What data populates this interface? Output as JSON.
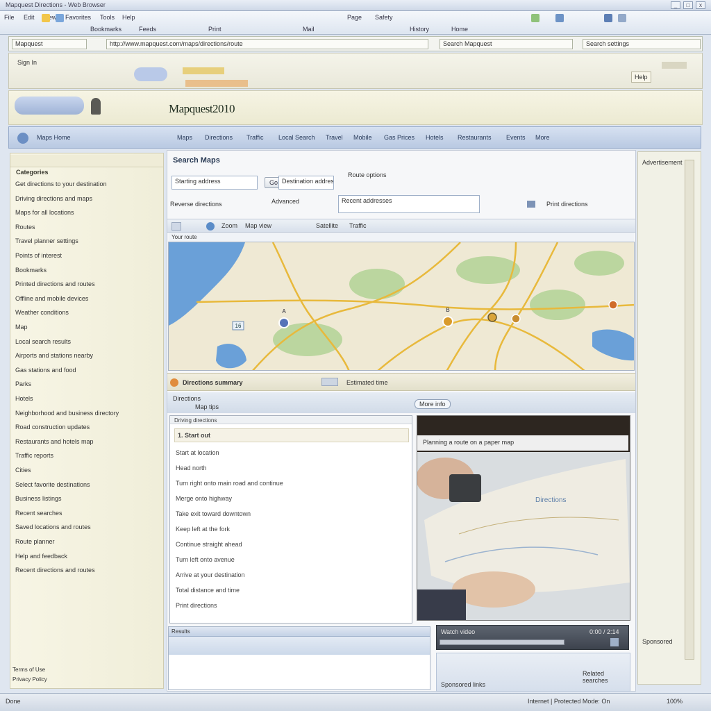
{
  "window": {
    "title": "Mapquest Directions - Web Browser",
    "controls": [
      "_",
      "□",
      "x"
    ]
  },
  "menubar": {
    "items": [
      "File",
      "Edit",
      "View",
      "Favorites",
      "Tools",
      "Help",
      "Page",
      "Safety"
    ],
    "links": [
      "Bookmarks",
      "Feeds",
      "Print",
      "Mail",
      "History",
      "Home"
    ]
  },
  "address": {
    "tab_label": "Mapquest",
    "url": "http://www.mapquest.com/maps/directions/route",
    "search_label": "Search Mapquest",
    "right_label": "Search settings"
  },
  "banner": {
    "logo": "Mapquest2010",
    "signin_label": "Sign In",
    "help_label": "Help"
  },
  "nav": {
    "home_label": "Maps Home",
    "links": [
      "Maps",
      "Directions",
      "Traffic",
      "Local Search",
      "Travel",
      "Mobile",
      "Gas Prices",
      "Hotels",
      "Restaurants",
      "Events",
      "More"
    ]
  },
  "sidebar": {
    "heading": "Categories",
    "items": [
      "Get directions to your destination",
      "Driving directions and maps",
      "Maps for all locations",
      "Routes",
      "Travel planner settings",
      "Points of interest",
      "Bookmarks",
      "Printed directions and routes",
      "Offline and mobile devices",
      "Weather conditions",
      "Map",
      "Local search results",
      "Airports and stations nearby",
      "Gas stations and food",
      "Parks",
      "Hotels",
      "Neighborhood and business directory",
      "Road construction updates",
      "Restaurants and hotels map",
      "Traffic reports",
      "Cities",
      "Select favorite destinations",
      "Business listings",
      "Recent searches",
      "Saved locations and routes",
      "Route planner",
      "Help and feedback",
      "Recent directions and routes"
    ],
    "footer_a": "Terms of Use",
    "footer_b": "Privacy Policy"
  },
  "search": {
    "heading": "Search Maps",
    "start_placeholder": "Starting address",
    "end_placeholder": "Destination address",
    "go_label": "Go",
    "options_label": "Route options",
    "reverse_label": "Reverse directions",
    "advanced_label": "Advanced",
    "recent_label": "Recent addresses"
  },
  "maptoolbar": {
    "zoom_label": "Zoom",
    "view_label": "Map view",
    "layer_label": "Satellite",
    "traffic_label": "Traffic",
    "print_label": "Print directions"
  },
  "map": {
    "route_label": "Your route",
    "marker_labels": [
      "A",
      "B"
    ],
    "highway": "16",
    "colors": {
      "water": "#6aa0d8",
      "land": "#efe9d4",
      "park": "#a9cf8e",
      "road": "#e8b93c"
    }
  },
  "results": {
    "heading": "Directions summary",
    "time_label": "Estimated time",
    "more_label": "More info",
    "tab1": "Directions",
    "tab2": "Map tips"
  },
  "article": {
    "title": "Driving directions",
    "step_heading": "1. Start out",
    "lines": [
      "Start at location",
      "Head north",
      "Turn right onto main road and continue",
      "Merge onto highway",
      "Take exit toward downtown",
      "Keep left at the fork",
      "Continue straight ahead",
      "Turn left onto avenue",
      "Arrive at your destination",
      "Total distance and time",
      "Print directions"
    ]
  },
  "photo": {
    "caption": "Planning a route on a paper map",
    "map_text": "Directions",
    "video_title": "Watch video",
    "video_time": "0:00 / 2:14"
  },
  "lower": {
    "tab_label": "Results",
    "link1": "Related searches",
    "link2": "Sponsored links"
  },
  "rightrail": {
    "heading": "Advertisement",
    "footer": "Sponsored"
  },
  "status": {
    "text": "Done",
    "zone": "Internet | Protected Mode: On",
    "zoom": "100%"
  }
}
